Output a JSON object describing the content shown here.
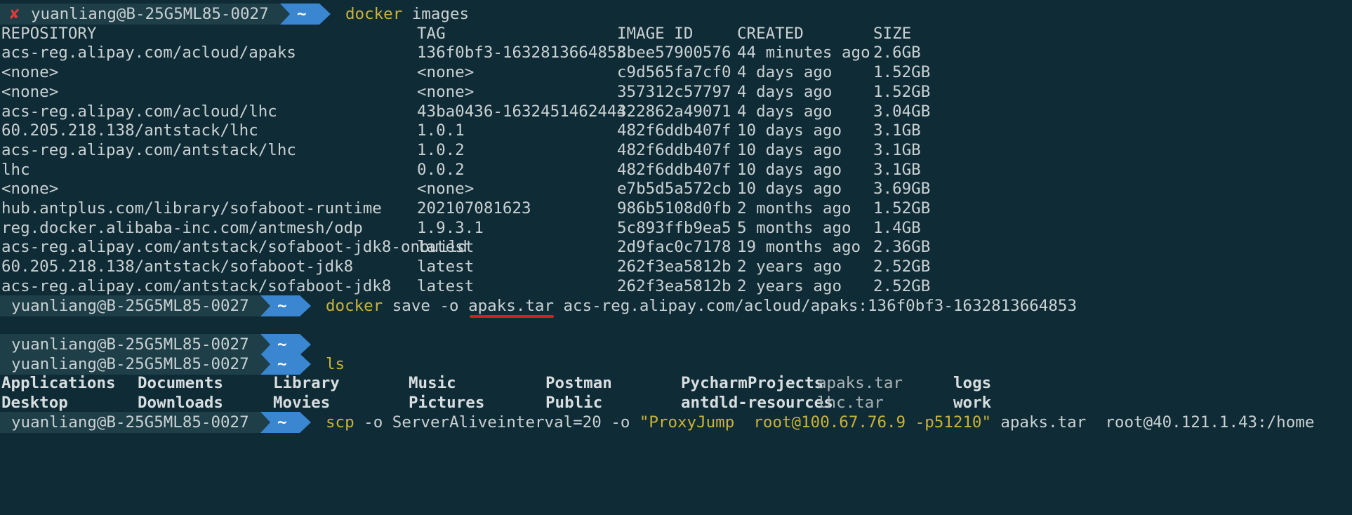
{
  "prompt": {
    "user_host": "yuanliang@B-25G5ML85-0027",
    "dir": "~",
    "error_mark": "✘"
  },
  "commands": {
    "images": {
      "kw": "docker",
      "rest": "images"
    },
    "save": {
      "kw": "docker",
      "rest_before": "save -o ",
      "file": "apaks.tar",
      "rest_after": " acs-reg.alipay.com/acloud/apaks:136f0bf3-1632813664853"
    },
    "ls": {
      "kw": "ls"
    },
    "scp": {
      "kw": "scp",
      "rest_a": " -o ServerAliveinterval=20 -o ",
      "quoted": "\"ProxyJump  root@100.67.76.9 -p51210\"",
      "rest_b": " apaks.tar  root@40.121.1.43:/home"
    }
  },
  "table": {
    "headers": [
      "REPOSITORY",
      "TAG",
      "IMAGE ID",
      "CREATED",
      "SIZE"
    ],
    "rows": [
      [
        "acs-reg.alipay.com/acloud/apaks",
        "136f0bf3-1632813664853",
        "8bee57900576",
        "44 minutes ago",
        "2.6GB"
      ],
      [
        "<none>",
        "<none>",
        "c9d565fa7cf0",
        "4 days ago",
        "1.52GB"
      ],
      [
        "<none>",
        "<none>",
        "357312c57797",
        "4 days ago",
        "1.52GB"
      ],
      [
        "acs-reg.alipay.com/acloud/lhc",
        "43ba0436-1632451462444",
        "322862a49071",
        "4 days ago",
        "3.04GB"
      ],
      [
        "60.205.218.138/antstack/lhc",
        "1.0.1",
        "482f6ddb407f",
        "10 days ago",
        "3.1GB"
      ],
      [
        "acs-reg.alipay.com/antstack/lhc",
        "1.0.2",
        "482f6ddb407f",
        "10 days ago",
        "3.1GB"
      ],
      [
        "lhc",
        "0.0.2",
        "482f6ddb407f",
        "10 days ago",
        "3.1GB"
      ],
      [
        "<none>",
        "<none>",
        "e7b5d5a572cb",
        "10 days ago",
        "3.69GB"
      ],
      [
        "hub.antplus.com/library/sofaboot-runtime",
        "202107081623",
        "986b5108d0fb",
        "2 months ago",
        "1.52GB"
      ],
      [
        "reg.docker.alibaba-inc.com/antmesh/odp",
        "1.9.3.1",
        "5c893ffb9ea5",
        "5 months ago",
        "1.4GB"
      ],
      [
        "acs-reg.alipay.com/antstack/sofaboot-jdk8-onbuild",
        "latest",
        "2d9fac0c7178",
        "19 months ago",
        "2.36GB"
      ],
      [
        "60.205.218.138/antstack/sofaboot-jdk8",
        "latest",
        "262f3ea5812b",
        "2 years ago",
        "2.52GB"
      ],
      [
        "acs-reg.alipay.com/antstack/sofaboot-jdk8",
        "latest",
        "262f3ea5812b",
        "2 years ago",
        "2.52GB"
      ]
    ]
  },
  "ls_output": {
    "row1": [
      {
        "name": "Applications",
        "type": "dir"
      },
      {
        "name": "Documents",
        "type": "dir"
      },
      {
        "name": "Library",
        "type": "dir"
      },
      {
        "name": "Music",
        "type": "dir"
      },
      {
        "name": "Postman",
        "type": "dir"
      },
      {
        "name": "PycharmProjects",
        "type": "dir"
      },
      {
        "name": "apaks.tar",
        "type": "file"
      },
      {
        "name": "logs",
        "type": "dir"
      }
    ],
    "row2": [
      {
        "name": "Desktop",
        "type": "dir"
      },
      {
        "name": "Downloads",
        "type": "dir"
      },
      {
        "name": "Movies",
        "type": "dir"
      },
      {
        "name": "Pictures",
        "type": "dir"
      },
      {
        "name": "Public",
        "type": "dir"
      },
      {
        "name": "antdld-resources",
        "type": "dir"
      },
      {
        "name": "lhc.tar",
        "type": "file"
      },
      {
        "name": "work",
        "type": "dir"
      }
    ]
  },
  "colors": {
    "background": "#0f2b35",
    "prompt_bg": "#1e3e48",
    "dir_arrow": "#3a86d0",
    "command_keyword": "#c9b33a",
    "error_mark": "#e03b3b",
    "annotation_underline": "#d21f1f"
  },
  "icons": {
    "error": "cross-mark-icon",
    "dir_segment": "powerline-arrow-icon"
  }
}
